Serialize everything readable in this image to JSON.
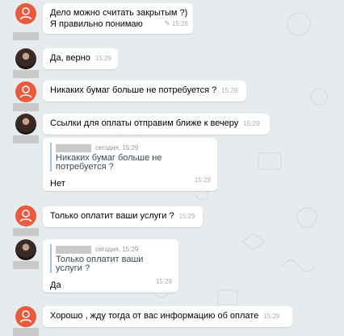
{
  "colors": {
    "background": "#e6ebee",
    "bubble": "#ffffff",
    "avatar_default": "#ec5a3d",
    "timestamp": "#a3adb6",
    "quote_bar": "#a9c4dd"
  },
  "messages": [
    {
      "lines": [
        "Дело можно считать закрытым ?)",
        "Я правильно понимаю"
      ],
      "time": "15:28",
      "edited_icon": "pencil-icon",
      "sender": "other"
    },
    {
      "text": "Да, верно",
      "time": "15:29",
      "sender": "me"
    },
    {
      "text": "Никаких бумаг больше не потребуется ?",
      "time": "15:29",
      "sender": "other"
    },
    {
      "text": "Ссылки для оплаты отправим ближе к вечеру",
      "time": "15:29",
      "sender": "me"
    },
    {
      "quote": {
        "date": "сегодня, 15:29",
        "lines": [
          "Никаких бумаг больше не",
          "потребуется ?"
        ]
      },
      "text": "Нет",
      "time": "15:29",
      "sender": "me"
    },
    {
      "text": "Только оплатит ваши услуги ?",
      "time": "15:29",
      "sender": "other"
    },
    {
      "quote": {
        "date": "сегодня, 15:29",
        "lines": [
          "Только оплатит ваши",
          "услуги ?"
        ]
      },
      "text": "Да",
      "time": "15:29",
      "sender": "me"
    },
    {
      "text": "Хорошо , жду тогда от вас информацию об оплате",
      "time": "15:29",
      "sender": "other"
    }
  ]
}
